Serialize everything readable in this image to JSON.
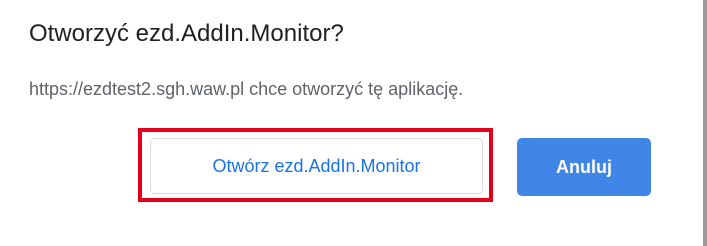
{
  "dialog": {
    "title": "Otworzyć ezd.AddIn.Monitor?",
    "message": "https://ezdtest2.sgh.waw.pl chce otworzyć tę aplikację.",
    "open_button_label": "Otwórz ezd.AddIn.Monitor",
    "cancel_button_label": "Anuluj"
  },
  "colors": {
    "highlight_border": "#e3001b",
    "primary_button": "#3f86e6",
    "link_text": "#1a73e8"
  }
}
